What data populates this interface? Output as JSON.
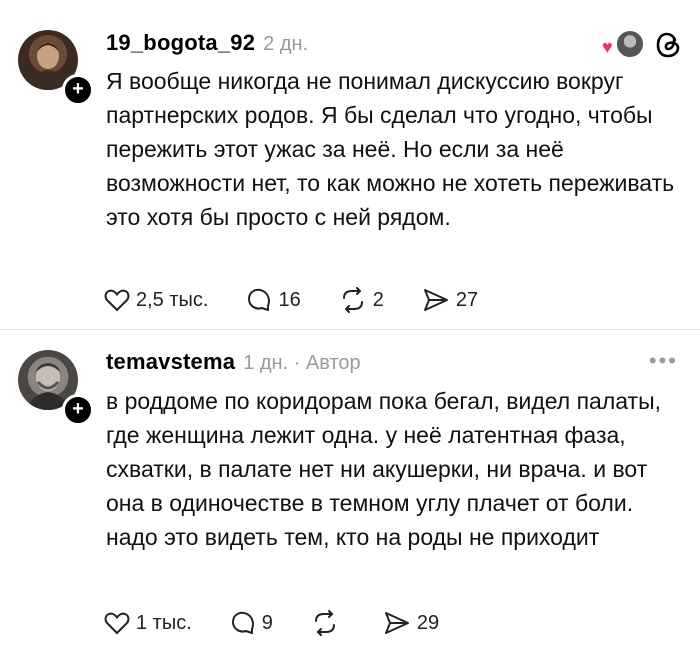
{
  "comments": [
    {
      "username": "19_bogota_92",
      "meta": "2 дн.",
      "text": "Я вообще никогда не понимал дискуссию вокруг партнерских родов. Я бы сделал что угодно, чтобы пережить этот ужас за неё. Но если за неё возможности нет, то как можно не хотеть переживать это хотя бы просто с ней рядом.",
      "likes": "2,5 тыс.",
      "replies": "16",
      "reposts": "2",
      "shares": "27"
    },
    {
      "username": "temavstema",
      "meta": "1 дн. · Автор",
      "text": "в роддоме по коридорам пока бегал, видел палаты, где женщина лежит одна. у неё латентная фаза, схватки, в палате нет ни акушерки, ни врача. и вот она в одиночестве в темном углу плачет от боли. надо это видеть тем, кто на роды не приходит",
      "likes": "1 тыс.",
      "replies": "9",
      "reposts": "",
      "shares": "29"
    }
  ],
  "icons": {
    "follow": "+",
    "more": "•••"
  },
  "colors": {
    "meta_gray": "#9a9a9a",
    "heart_red": "#ff2d55"
  }
}
